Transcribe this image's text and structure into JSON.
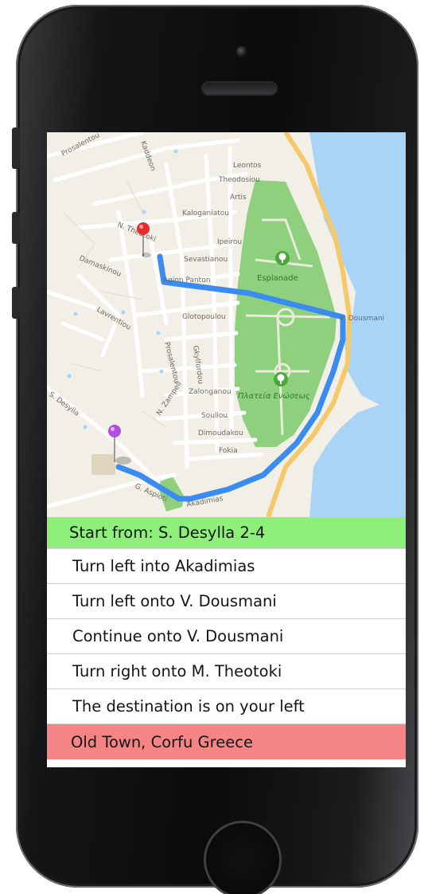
{
  "map": {
    "street_labels": [
      "Leontos",
      "Theodosiou",
      "Artis",
      "Kaloganiatou",
      "Ipeirou",
      "N. Theotoki",
      "Sevastianou",
      "Agion Panton",
      "Glotopoulou",
      "Damaskinou",
      "Lavrentiou",
      "Gkylfordou",
      "Zalonganou",
      "Souliou",
      "Dimoudakou",
      "Fokia",
      "S. Desylla",
      "G. Aspioti",
      "Akadimias",
      "V. Dousmani",
      "N. Zampeli",
      "Prosalentou",
      "Kaddeon"
    ],
    "poi_labels": [
      "Esplanade",
      "Πλατεία Ενώσεως"
    ],
    "colors": {
      "land": "#f2efe6",
      "street": "#ffffff",
      "park": "#8fd07f",
      "water": "#a9d4f5",
      "coast_road": "#f5c96a",
      "route": "#3b8cf0",
      "start_pin": "#b14fe0",
      "destination_pin": "#e62c2c"
    },
    "icons": [
      "start-pin-icon",
      "destination-pin-icon",
      "tree-icon"
    ]
  },
  "directions": {
    "start": "Start from: S. Desylla 2-4",
    "steps": [
      "Turn left into Akadimias",
      "Turn left onto V. Dousmani",
      "Continue onto V. Dousmani",
      "Turn right onto M. Theotoki",
      "The destination is on your left"
    ],
    "destination": "Old Town, Corfu Greece"
  }
}
